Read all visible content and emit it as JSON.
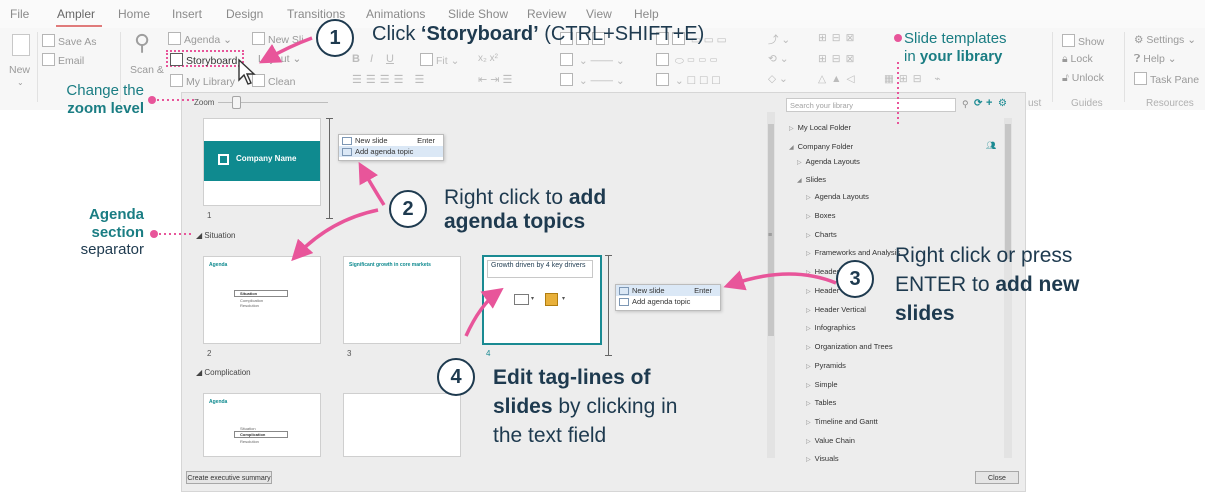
{
  "menu": {
    "items": [
      "File",
      "Ampler",
      "Home",
      "Insert",
      "Design",
      "Transitions",
      "Animations",
      "Slide Show",
      "Review",
      "View",
      "Help"
    ],
    "active": "Ampler"
  },
  "ribbon": {
    "new": "New",
    "save_as": "Save As",
    "email": "Email",
    "scan": "Scan &",
    "agenda": "Agenda",
    "storyboard": "Storyboard",
    "my_library": "My Library",
    "new_slide": "New Sli",
    "layout": "Layout",
    "clean": "Clean",
    "fit": "Fit",
    "show": "Show",
    "lock": "Lock",
    "unlock": "Unlock",
    "settings": "Settings",
    "help": "Help",
    "task_pane": "Task Pane",
    "group_adjust": "ust",
    "group_guides": "Guides",
    "group_resources": "Resources"
  },
  "dialog": {
    "zoom_label": "Zoom",
    "search_placeholder": "Search your library",
    "create_summary_button": "Create executive summary",
    "close_button": "Close",
    "slides": {
      "s1": {
        "num": "1",
        "company": "Company Name"
      },
      "section_situation": "Situation",
      "s2": {
        "num": "2",
        "title": "Agenda",
        "items": [
          "Situation",
          "Complication",
          "Resolution"
        ]
      },
      "s3": {
        "num": "3",
        "title": "Significant growth in core markets"
      },
      "s4": {
        "num": "4",
        "title": "Growth driven by 4 key drivers"
      },
      "section_complication": "Complication",
      "s5": {
        "title": "Agenda",
        "items": [
          "Situation",
          "Complication",
          "Resolution"
        ]
      }
    },
    "ctx_menu": {
      "new_slide": "New slide",
      "enter": "Enter",
      "add_agenda": "Add agenda topic"
    },
    "library": {
      "my_local": "My Local Folder",
      "company": "Company Folder",
      "items": [
        "Agenda Layouts",
        "Slides",
        "Agenda Layouts",
        "Boxes",
        "Charts",
        "Frameworks and Analysis",
        "Header",
        "Header",
        "Header Vertical",
        "Infographics",
        "Organization and Trees",
        "Pyramids",
        "Simple",
        "Tables",
        "Timeline and Gantt",
        "Value Chain",
        "Visuals"
      ]
    }
  },
  "annotations": {
    "step1_num": "1",
    "step1_a": "Click ",
    "step1_b": "‘Storyboard’",
    "step1_c": " (CTRL+SHIFT+E)",
    "step2_num": "2",
    "step2_a": "Right click to ",
    "step2_b": "add",
    "step2_c": "agenda topics",
    "step3_num": "3",
    "step3_a": "Right click or press",
    "step3_b": "ENTER to ",
    "step3_c": "add new",
    "step3_d": "slides",
    "step4_num": "4",
    "step4_a": "Edit tag-lines of",
    "step4_b": "slides",
    "step4_c": " by clicking in",
    "step4_d": "the text field",
    "zoom_a": "Change the",
    "zoom_b": "zoom level",
    "agenda_a": "Agenda",
    "agenda_b": "section",
    "agenda_c": "separator",
    "templates_a": "Slide templates",
    "templates_b": "in ",
    "templates_c": "your library"
  },
  "colors": {
    "teal": "#0f8a8f",
    "navy": "#1e3a4f",
    "pink": "#e8559a",
    "annotation_teal": "#1a7d83"
  }
}
